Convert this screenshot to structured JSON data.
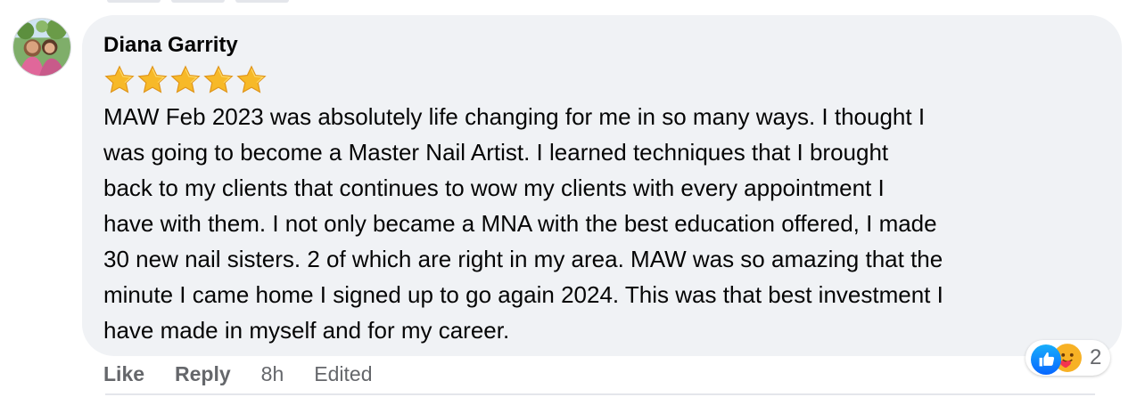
{
  "comment": {
    "author": "Diana Garrity",
    "rating_stars": 5,
    "body_lines": [
      "MAW Feb 2023 was absolutely life changing for me in so many ways. I thought I",
      "was going to become a Master Nail Artist. I learned techniques that I brought",
      "back to my clients that continues to wow my clients with every appointment I",
      "have with them. I not only became a MNA with the best education offered, I made",
      "30 new nail sisters. 2 of which are right in my area. MAW was so amazing that the",
      "minute I came home I signed up to go again 2024. This was that best investment I",
      "have made in myself and for my career."
    ],
    "actions": {
      "like": "Like",
      "reply": "Reply",
      "time": "8h",
      "edited": "Edited"
    },
    "reactions": {
      "icons": [
        "like-icon",
        "care-icon"
      ],
      "count": "2"
    }
  },
  "colors": {
    "bubble": "#f0f2f5",
    "secondary_text": "#65676b",
    "like_blue": "#1877f2",
    "star_gold": "#f7b928"
  }
}
